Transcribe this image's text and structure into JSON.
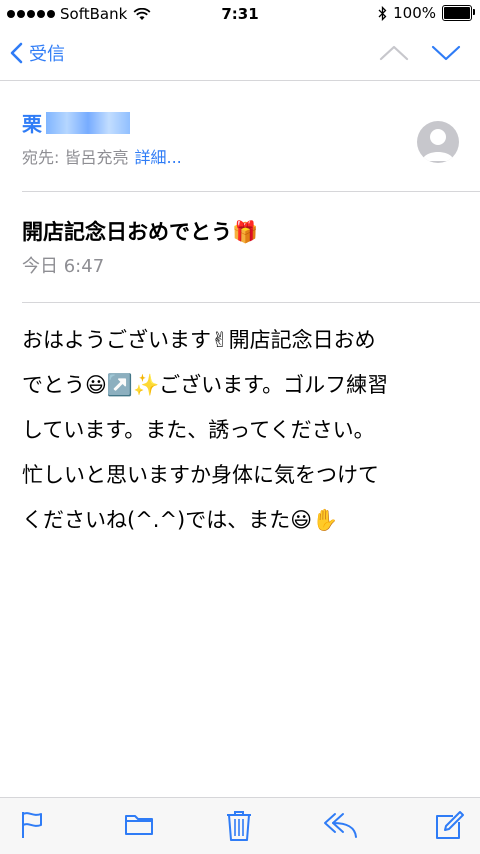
{
  "status_bar": {
    "carrier": "SoftBank",
    "time": "7:31",
    "battery": "100%",
    "battery_level": 1.0
  },
  "nav": {
    "back_label": "受信"
  },
  "sender": {
    "name_visible": "栗",
    "to_label": "宛先: 皆呂充亮",
    "details_label": "詳細..."
  },
  "message": {
    "subject": "開店記念日おめでとう🎁",
    "date": "今日 6:47",
    "body_lines": [
      "おはようございます✌開店記念日おめ",
      "でとう😃↗️✨ございます。ゴルフ練習",
      "しています。また、誘ってください。",
      "忙しいと思いますか身体に気をつけて",
      "くださいね(^.^)では、また😃✋"
    ]
  },
  "colors": {
    "accent": "#2f7cf6",
    "secondary_text": "#8e8e93",
    "divider": "#d6d6d9",
    "toolbar_bg": "#f7f7f7"
  },
  "icons": {
    "toolbar": [
      "flag-icon",
      "folder-icon",
      "trash-icon",
      "reply-icon",
      "compose-icon"
    ]
  }
}
